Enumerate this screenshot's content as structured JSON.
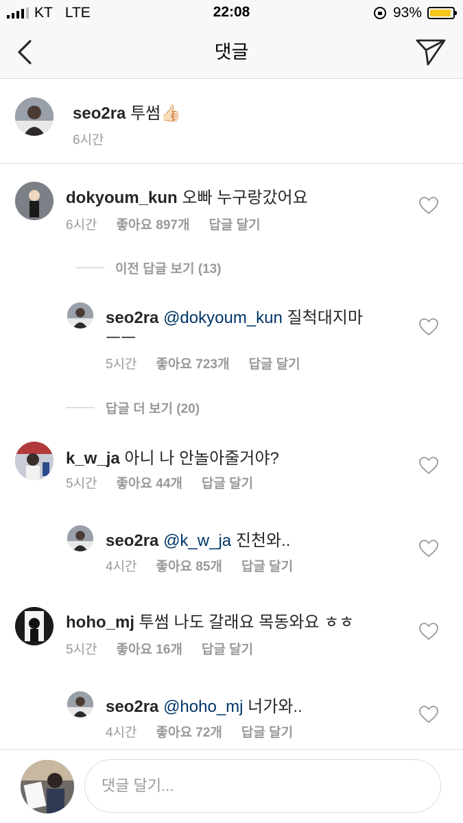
{
  "status": {
    "carrier": "KT",
    "network": "LTE",
    "time": "22:08",
    "battery": "93%",
    "battery_level": 0.93
  },
  "header": {
    "title": "댓글",
    "back_icon": "chevron-left-icon",
    "share_icon": "paper-plane-icon"
  },
  "post": {
    "username": "seo2ra",
    "text": "투썸👍🏻",
    "time": "6시간"
  },
  "comments": [
    {
      "username": "dokyoum_kun",
      "text": "오빠 누구랑갔어요",
      "time": "6시간",
      "likes": "좋아요 897개",
      "reply": "답글 달기"
    },
    {
      "prev_replies": "이전 답글 보기 (13)"
    },
    {
      "username": "seo2ra",
      "mention": "@dokyoum_kun",
      "text": "질척대지마",
      "text2": "ㅡㅡ",
      "time": "5시간",
      "likes": "좋아요 723개",
      "reply": "답글 달기"
    },
    {
      "more_replies": "답글 더 보기 (20)"
    },
    {
      "username": "k_w_ja",
      "text": "아니 나 안놀아줄거야?",
      "time": "5시간",
      "likes": "좋아요 44개",
      "reply": "답글 달기"
    },
    {
      "username": "seo2ra",
      "mention": "@k_w_ja",
      "text": "진천와..",
      "time": "4시간",
      "likes": "좋아요 85개",
      "reply": "답글 달기"
    },
    {
      "username": "hoho_mj",
      "text": "투썸 나도 갈래요 목동와요 ㅎㅎ",
      "time": "5시간",
      "likes": "좋아요 16개",
      "reply": "답글 달기"
    },
    {
      "username": "seo2ra",
      "mention": "@hoho_mj",
      "text": "너가와..",
      "time": "4시간",
      "likes": "좋아요 72개",
      "reply": "답글 달기"
    }
  ],
  "composer": {
    "placeholder": "댓글 달기..."
  },
  "colors": {
    "mention": "#003569",
    "meta": "#999999",
    "battery": "#f5c518"
  }
}
